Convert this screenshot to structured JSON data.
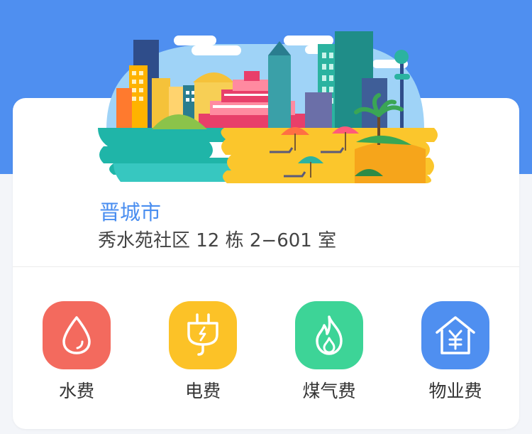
{
  "location": {
    "city": "晋城市",
    "address": "秀水苑社区 12 栋 2−601 室"
  },
  "services": [
    {
      "label": "水费",
      "icon": "water-drop-icon",
      "color": "#f36a5e"
    },
    {
      "label": "电费",
      "icon": "electric-plug-icon",
      "color": "#fcc227"
    },
    {
      "label": "煤气费",
      "icon": "flame-icon",
      "color": "#3dd497"
    },
    {
      "label": "物业费",
      "icon": "house-yen-icon",
      "color": "#4f8ff0"
    }
  ],
  "colors": {
    "header_blue": "#4f8ff0",
    "city_text": "#4a8ef0"
  }
}
